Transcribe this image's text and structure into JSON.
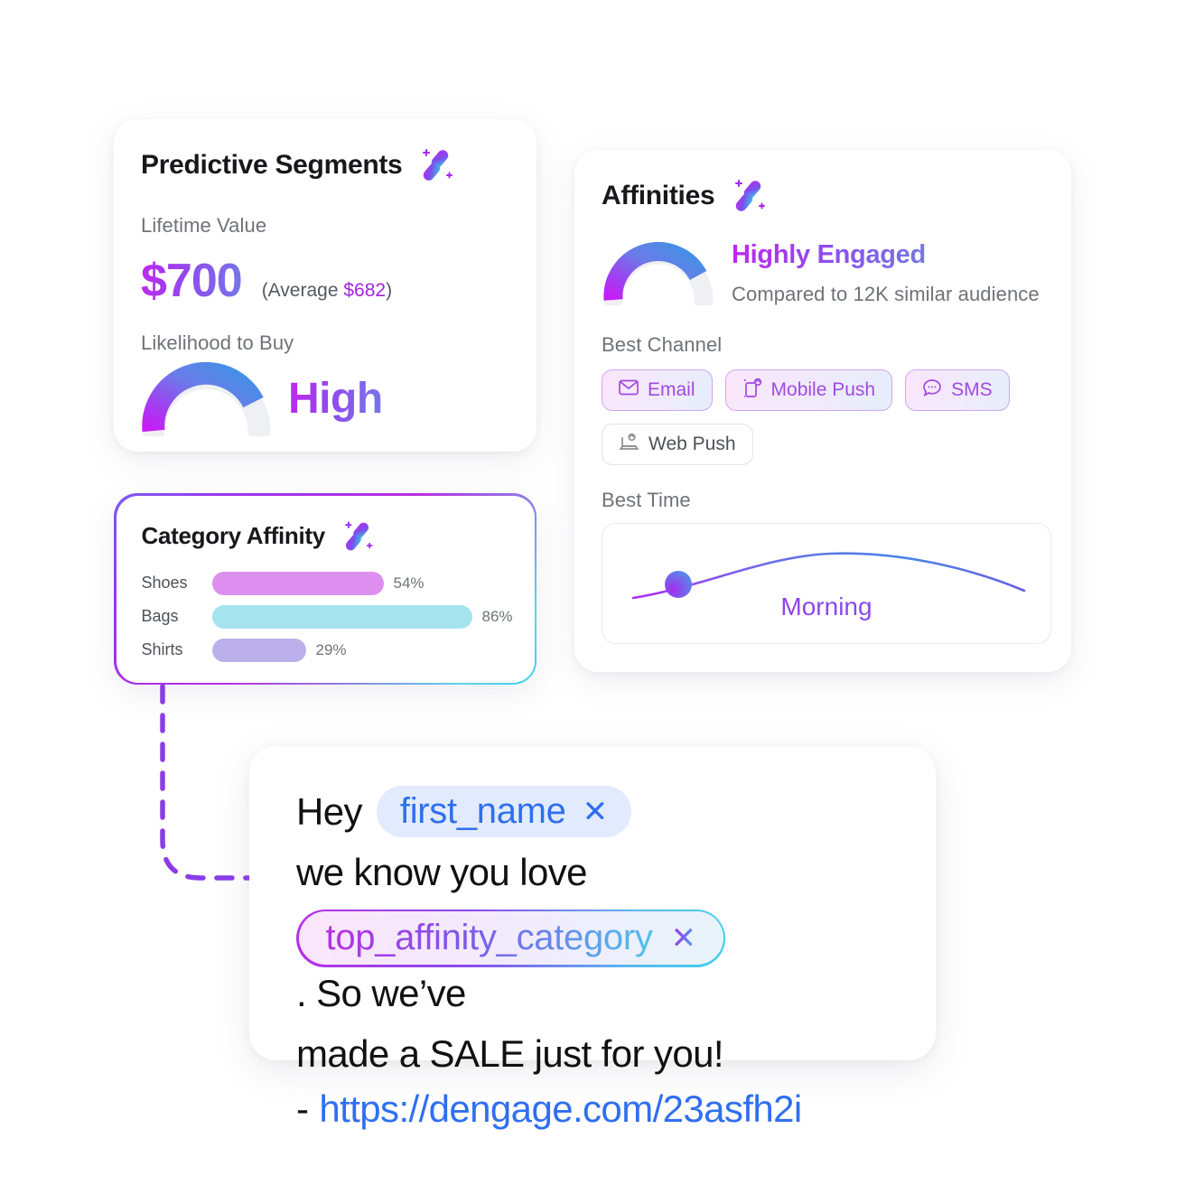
{
  "theme": {
    "background": "#ffffff",
    "accent_purple": "#a322e0",
    "accent_blue": "#2f6fef",
    "accent_cyan": "#3fd0e8",
    "gradient_start": "#c026f0",
    "gradient_end": "#7579e6",
    "muted_text": "#6f7278"
  },
  "predictive_segments": {
    "title": "Predictive Segments",
    "ai_icon": "ai-sparkle-icon",
    "ltv_label": "Lifetime Value",
    "ltv_value": "$700",
    "ltv_average_prefix": "(Average ",
    "ltv_average_value": "$682",
    "ltv_average_suffix": ")",
    "likelihood_label": "Likelihood to Buy",
    "likelihood_value": "High",
    "gauge_percent": 80
  },
  "affinities": {
    "title": "Affinities",
    "ai_icon": "ai-sparkle-icon",
    "engagement_status": "Highly Engaged",
    "comparison_text": "Compared to 12K similar audience",
    "gauge_percent": 80,
    "best_channel_label": "Best Channel",
    "channels": [
      {
        "label": "Email",
        "icon": "envelope-icon",
        "active": true
      },
      {
        "label": "Mobile Push",
        "icon": "mobile-push-icon",
        "active": true
      },
      {
        "label": "SMS",
        "icon": "chat-bubble-icon",
        "active": true
      },
      {
        "label": "Web Push",
        "icon": "web-push-icon",
        "active": false
      }
    ],
    "best_time_label": "Best Time",
    "best_time_value": "Morning"
  },
  "category_affinity": {
    "title": "Category Affinity",
    "ai_icon": "ai-sparkle-icon"
  },
  "chart_data": {
    "type": "bar",
    "title": "Category Affinity",
    "orientation": "horizontal",
    "categories": [
      "Shoes",
      "Bags",
      "Shirts"
    ],
    "values": [
      54,
      86,
      29
    ],
    "value_labels": [
      "54%",
      "86%",
      "29%"
    ],
    "colors": [
      "#dd8ff0",
      "#a5e4ef",
      "#bcb0ec"
    ],
    "xlabel": "",
    "ylabel": "",
    "xlim": [
      0,
      100
    ],
    "grid": false,
    "legend": "none"
  },
  "message": {
    "line1_prefix": "Hey",
    "token_first_name": "first_name",
    "token_close": "✕",
    "line1_suffix": "we know you love",
    "token_top_affinity": "top_affinity_category",
    "line2_suffix": ". So we’ve",
    "line3": "made a SALE just for you!",
    "line4_dash": "-",
    "line4_link": "https://dengage.com/23asfh2i"
  },
  "connector": {
    "name": "dashed-arrow-connector",
    "color": "#8b3ce8",
    "style": "dashed",
    "arrowhead": true
  }
}
